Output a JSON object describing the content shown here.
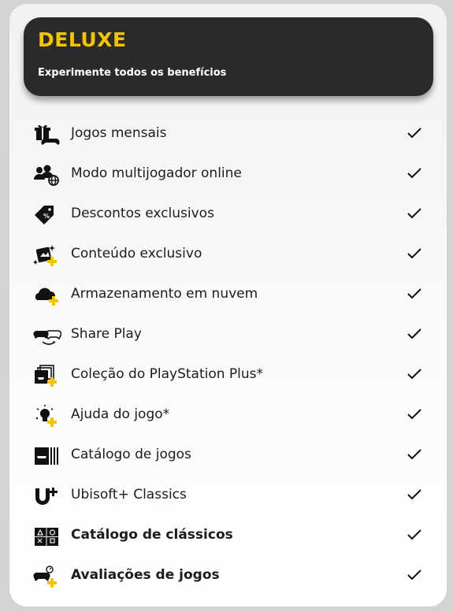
{
  "plan": {
    "tier": "DELUXE",
    "tagline": "Experimente todos os benefícios",
    "accent_color": "#f5c400",
    "header_background": "#2b2a29"
  },
  "benefits": [
    {
      "label": "Jogos mensais",
      "icon": "gift-controller-icon",
      "included": true,
      "bold": false
    },
    {
      "label": "Modo multijogador online",
      "icon": "online-multiplayer-icon",
      "included": true,
      "bold": false
    },
    {
      "label": "Descontos exclusivos",
      "icon": "discount-tag-icon",
      "included": true,
      "bold": false
    },
    {
      "label": "Conteúdo exclusivo",
      "icon": "exclusive-content-icon",
      "included": true,
      "bold": false
    },
    {
      "label": "Armazenamento em nuvem",
      "icon": "cloud-storage-icon",
      "included": true,
      "bold": false
    },
    {
      "label": "Share Play",
      "icon": "share-play-icon",
      "included": true,
      "bold": false
    },
    {
      "label": "Coleção do PlayStation Plus*",
      "icon": "ps-plus-collection-icon",
      "included": true,
      "bold": false
    },
    {
      "label": "Ajuda do jogo*",
      "icon": "game-help-icon",
      "included": true,
      "bold": false
    },
    {
      "label": "Catálogo de jogos",
      "icon": "game-catalog-icon",
      "included": true,
      "bold": false
    },
    {
      "label": "Ubisoft+ Classics",
      "icon": "ubisoft-plus-icon",
      "included": true,
      "bold": false
    },
    {
      "label": "Catálogo de clássicos",
      "icon": "classics-catalog-icon",
      "included": true,
      "bold": true
    },
    {
      "label": "Avaliações de jogos",
      "icon": "game-trials-icon",
      "included": true,
      "bold": true
    }
  ]
}
